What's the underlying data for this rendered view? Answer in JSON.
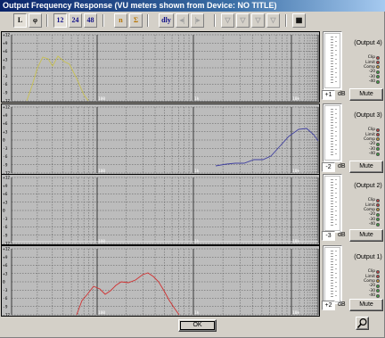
{
  "window": {
    "title": "Output Frequency Response  (VU meters shown from Device: NO TITLE)"
  },
  "toolbar": {
    "buttons": [
      {
        "name": "linear-view-button",
        "label": "L",
        "state": "pressed"
      },
      {
        "name": "phase-view-button",
        "label": "φ",
        "state": "normal"
      },
      {
        "name": "octave-12-button",
        "label": "12",
        "state": "pressed"
      },
      {
        "name": "octave-24-button",
        "label": "24",
        "state": "normal"
      },
      {
        "name": "octave-48-button",
        "label": "48",
        "state": "normal"
      },
      {
        "name": "individual-curve-button",
        "label": "n",
        "state": "disabled"
      },
      {
        "name": "sum-curve-button",
        "label": "Σ",
        "state": "disabled"
      },
      {
        "name": "delay-button",
        "label": "dly",
        "state": "normal"
      },
      {
        "name": "arrow-left-button",
        "label": "◂|",
        "state": "disabled"
      },
      {
        "name": "arrow-right-button",
        "label": "|▸",
        "state": "disabled"
      },
      {
        "name": "filter-1-button",
        "label": "▽",
        "state": "disabled"
      },
      {
        "name": "filter-2-button",
        "label": "▽",
        "state": "disabled"
      },
      {
        "name": "filter-3-button",
        "label": "▽",
        "state": "disabled"
      },
      {
        "name": "filter-4-button",
        "label": "▽",
        "state": "disabled"
      },
      {
        "name": "grid-button",
        "label": "▦",
        "state": "normal"
      }
    ]
  },
  "graph": {
    "y_ticks": [
      "+12",
      "+9",
      "+6",
      "+3",
      "0",
      "-3",
      "-6",
      "-9",
      "-12"
    ],
    "x_labels": [
      "100",
      "1k",
      "10k"
    ]
  },
  "outputs": [
    {
      "label": "(Output 4)",
      "gain": "+1",
      "gain_unit": "dB",
      "mute": "Mute",
      "leds": [
        {
          "t": "Clip",
          "c": "#d04040"
        },
        {
          "t": "Limit",
          "c": "#d04040"
        },
        {
          "t": "Comp",
          "c": "#d0a030"
        },
        {
          "t": "-20",
          "c": "#40b040"
        },
        {
          "t": "-30",
          "c": "#40b040"
        },
        {
          "t": "-40",
          "c": "#40b040"
        }
      ],
      "curve_color": "#c8c050"
    },
    {
      "label": "(Output 3)",
      "gain": "-2",
      "gain_unit": "dB",
      "mute": "Mute",
      "leds": [
        {
          "t": "Clip",
          "c": "#d04040"
        },
        {
          "t": "Limit",
          "c": "#d04040"
        },
        {
          "t": "Comp",
          "c": "#d0a030"
        },
        {
          "t": "-20",
          "c": "#40b040"
        },
        {
          "t": "-30",
          "c": "#40b040"
        },
        {
          "t": "-40",
          "c": "#40b040"
        }
      ],
      "curve_color": "#4040a0"
    },
    {
      "label": "(Output 2)",
      "gain": "-3",
      "gain_unit": "dB",
      "mute": "Mute",
      "leds": [
        {
          "t": "Clip",
          "c": "#d04040"
        },
        {
          "t": "Limit",
          "c": "#d04040"
        },
        {
          "t": "Comp",
          "c": "#d0a030"
        },
        {
          "t": "-20",
          "c": "#40b040"
        },
        {
          "t": "-30",
          "c": "#40b040"
        },
        {
          "t": "-40",
          "c": "#40b040"
        }
      ],
      "curve_color": "#e0e0e0"
    },
    {
      "label": "(Output 1)",
      "gain": "+2",
      "gain_unit": "dB",
      "mute": "Mute",
      "leds": [
        {
          "t": "Clip",
          "c": "#d04040"
        },
        {
          "t": "Limit",
          "c": "#d04040"
        },
        {
          "t": "Comp",
          "c": "#d0a030"
        },
        {
          "t": "-20",
          "c": "#40b040"
        },
        {
          "t": "-30",
          "c": "#40b040"
        },
        {
          "t": "-40",
          "c": "#40b040"
        }
      ],
      "curve_color": "#d03030"
    }
  ],
  "footer": {
    "ok_label": "OK",
    "zoom_icon": "magnifier-icon"
  }
}
